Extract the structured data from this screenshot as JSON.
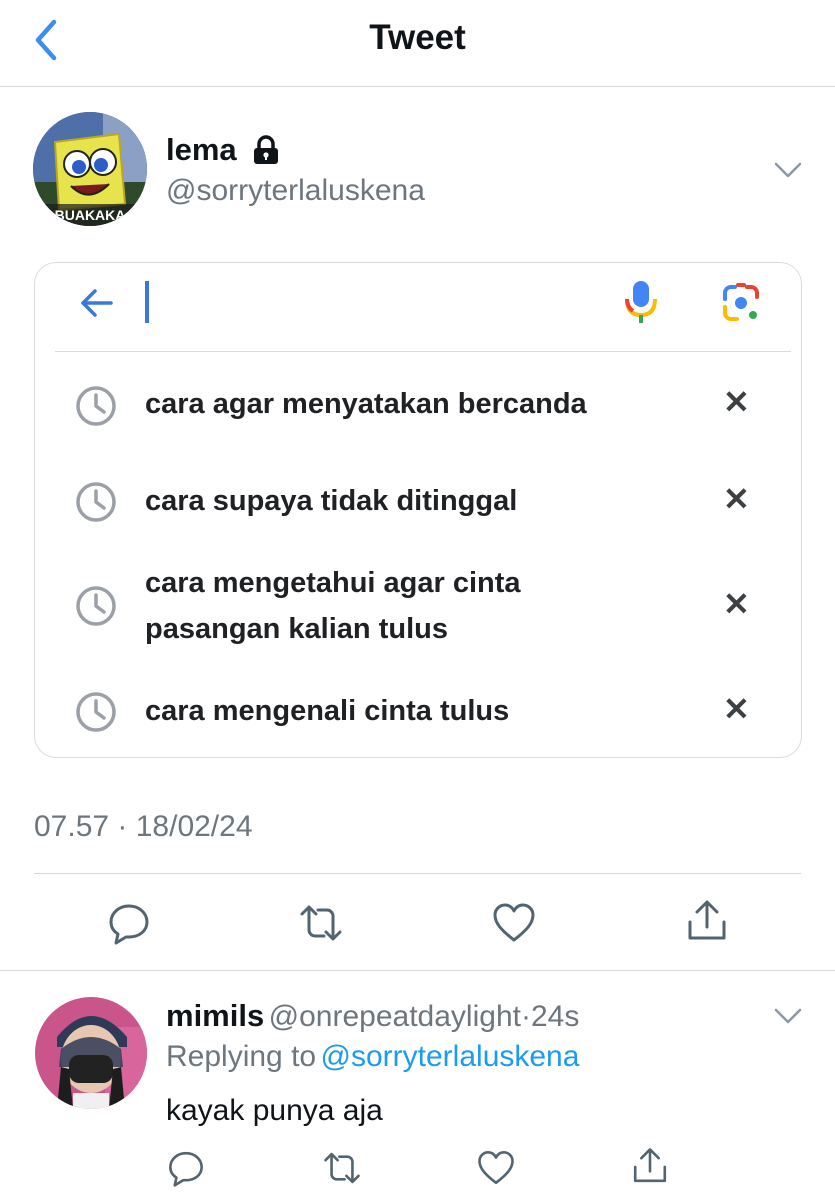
{
  "header": {
    "title": "Tweet",
    "back_icon": "chevron-left-icon"
  },
  "tweet": {
    "author_name": "lema",
    "author_handle": "@sorryterlaluskena",
    "avatar_caption": "BUAKAKA",
    "locked_icon": "lock-icon",
    "timestamp": "07.57 · 18/02/24",
    "image": {
      "search_bar": {
        "value": "",
        "back_icon": "arrow-left-icon",
        "mic_icon": "mic-icon",
        "lens_icon": "camera-lens-icon"
      },
      "suggestions": [
        {
          "lines": [
            "cara agar menyatakan bercanda"
          ]
        },
        {
          "lines": [
            "cara supaya tidak ditinggal"
          ]
        },
        {
          "lines": [
            "cara mengetahui agar cinta",
            "pasangan kalian tulus"
          ]
        },
        {
          "lines": [
            "cara mengenali cinta tulus"
          ]
        }
      ],
      "remove_symbol": "✕"
    },
    "actions": [
      "reply-icon",
      "retweet-icon",
      "like-icon",
      "share-icon"
    ]
  },
  "reply": {
    "author_name": "mimils",
    "author_handle": "@onrepeatdaylight",
    "separator": "·",
    "time": "24s",
    "replying_to_label": "Replying to",
    "replying_to_handle": "@sorryterlaluskena",
    "text": "kayak punya aja",
    "actions": [
      "reply-icon",
      "retweet-icon",
      "like-icon",
      "share-icon"
    ]
  },
  "colors": {
    "accent": "#1d9bf0",
    "back_chevron": "#3b8ef0",
    "secondary_text": "#6e767d",
    "divider": "#d6d9dc"
  }
}
